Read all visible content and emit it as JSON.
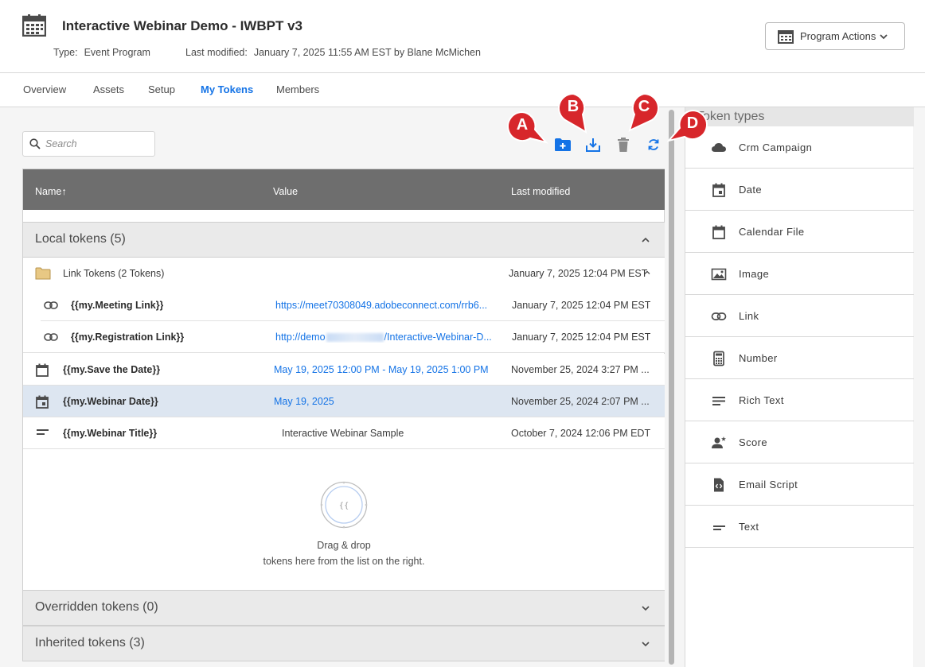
{
  "header": {
    "title": "Interactive Webinar Demo - IWBPT v3",
    "type_label": "Type:",
    "type_value": "Event Program",
    "modified_label": "Last modified:",
    "modified_value": "January 7, 2025 11:55 AM EST by Blane McMichen",
    "program_actions": "Program Actions"
  },
  "tabs": [
    {
      "label": "Overview"
    },
    {
      "label": "Assets"
    },
    {
      "label": "Setup"
    },
    {
      "label": "My Tokens",
      "active": true
    },
    {
      "label": "Members"
    }
  ],
  "search": {
    "placeholder": "Search"
  },
  "callouts": [
    "A",
    "B",
    "C",
    "D"
  ],
  "table": {
    "columns": [
      "Name↑",
      "Value",
      "Last modified"
    ],
    "local_section": "Local tokens (5)",
    "folder": {
      "name": "Link Tokens (2 Tokens)",
      "modified": "January 7, 2025 12:04 PM EST"
    },
    "rows": [
      {
        "name": "{{my.Meeting Link}}",
        "value": "https://meet70308049.adobeconnect.com/rrb6...",
        "modified": "January 7, 2025 12:04 PM EST"
      },
      {
        "name": "{{my.Registration Link}}",
        "value_prefix": "http://demo",
        "value_suffix": "/Interactive-Webinar-D...",
        "modified": "January 7, 2025 12:04 PM EST"
      },
      {
        "name": "{{my.Save the Date}}",
        "value": "May 19, 2025 12:00 PM - May 19, 2025 1:00 PM",
        "modified": "November 25, 2024 3:27 PM ..."
      },
      {
        "name": "{{my.Webinar Date}}",
        "value": "May 19, 2025",
        "modified": "November 25, 2024 2:07 PM ..."
      },
      {
        "name": "{{my.Webinar Title}}",
        "value": "Interactive Webinar Sample",
        "modified": "October 7, 2024 12:06 PM EDT"
      }
    ],
    "dropzone_glyph": "{{",
    "dropzone_line1": "Drag & drop",
    "dropzone_line2": "tokens here from the list on the right.",
    "overridden_section": "Overridden tokens (0)",
    "inherited_section": "Inherited tokens (3)"
  },
  "token_types": {
    "header": "Token types",
    "items": [
      {
        "label": "Crm Campaign",
        "icon": "cloud-icon"
      },
      {
        "label": "Date",
        "icon": "date-icon"
      },
      {
        "label": "Calendar File",
        "icon": "calendar-icon"
      },
      {
        "label": "Image",
        "icon": "image-icon"
      },
      {
        "label": "Link",
        "icon": "link-icon"
      },
      {
        "label": "Number",
        "icon": "calculator-icon"
      },
      {
        "label": "Rich Text",
        "icon": "rich-text-icon"
      },
      {
        "label": "Score",
        "icon": "score-icon"
      },
      {
        "label": "Email Script",
        "icon": "script-icon"
      },
      {
        "label": "Text",
        "icon": "text-icon"
      }
    ]
  },
  "colors": {
    "accent": "#1473e6",
    "callout": "#d7262b",
    "folder_bar": "#e68619",
    "header_bg": "#6e6e6e"
  }
}
